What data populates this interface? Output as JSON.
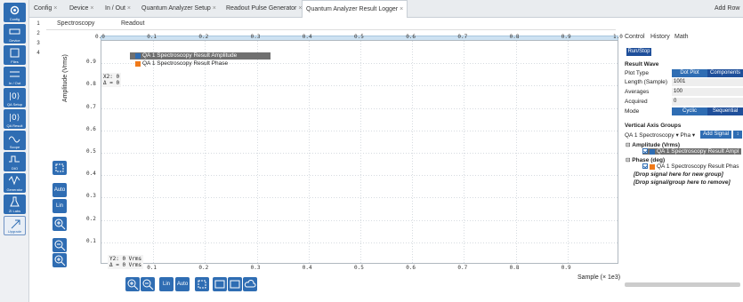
{
  "tabs": {
    "items": [
      "Config",
      "Device",
      "In / Out",
      "Quantum Analyzer Setup",
      "Readout Pulse Generator",
      "Quantum Analyzer Result Logger"
    ],
    "add_row": "Add Row"
  },
  "sidebar": {
    "items": [
      "Config",
      "Device",
      "Files",
      "In / Out",
      "QA Setup",
      "QA Result",
      "Scope",
      "DIO",
      "Generator",
      "ZI Labs",
      "Upgrade"
    ]
  },
  "rows": [
    "1",
    "2",
    "3",
    "4"
  ],
  "subtabs": {
    "spectroscopy": "Spectroscopy",
    "readout": "Readout"
  },
  "plot": {
    "ylabel": "Amplitude (Vrms)",
    "xlabel": "Sample (× 1e3)",
    "x2_readout": "X2: 0",
    "dx_readout": "Δ = 0",
    "y2_readout": "Y2: 0 Vrms",
    "dy_readout": "Δ = 0 Vrms",
    "legend": [
      {
        "label": "QA 1 Spectroscopy Result Amplitude",
        "color": "#2f6db3"
      },
      {
        "label": "QA 1 Spectroscopy Result Phase",
        "color": "#f07a1a"
      }
    ],
    "btn_auto": "Auto",
    "btn_lin": "Lin"
  },
  "chart_data": {
    "type": "line",
    "xlim": [
      0,
      1
    ],
    "ylim": [
      0,
      1
    ],
    "xticks": [
      "0.0",
      "0.1",
      "0.2",
      "0.3",
      "0.4",
      "0.5",
      "0.6",
      "0.7",
      "0.8",
      "0.9",
      "1.0"
    ],
    "xticks_bottom": [
      "0.1",
      "0.2",
      "0.3",
      "0.4",
      "0.5",
      "0.6",
      "0.7",
      "0.8",
      "0.9"
    ],
    "yticks": [
      "0.9",
      "0.8",
      "0.7",
      "0.6",
      "0.5",
      "0.4",
      "0.3",
      "0.2",
      "0.1"
    ],
    "ylabel": "Amplitude (Vrms)",
    "xlabel": "Sample (× 1e3)",
    "grid": true
  },
  "right": {
    "tabs": [
      "Control",
      "History",
      "Math"
    ],
    "run_stop": "Run/Stop",
    "result_wave": "Result Wave",
    "plot_type_label": "Plot Type",
    "plot_type_dot": "Dot Plot",
    "plot_type_comp": "Components",
    "length_label": "Length (Sample)",
    "length_value": "1001",
    "averages_label": "Averages",
    "averages_value": "100",
    "acquired_label": "Acquired",
    "acquired_value": "0",
    "mode_label": "Mode",
    "mode_cyclic": "Cyclic",
    "mode_seq": "Sequential",
    "vag": "Vertical Axis Groups",
    "vag_select": "QA 1 Spectroscopy",
    "vag_select2": "Pha",
    "add_signal": "Add Signal",
    "tree": {
      "amp": "Amplitude (Vrms)",
      "amp_sig": "QA 1 Spectroscopy Result Ampl",
      "phase": "Phase (deg)",
      "phase_sig": "QA 1 Spectroscopy Result Phas",
      "drop_new": "[Drop signal here for new group]",
      "drop_remove": "[Drop signal/group here to remove]"
    }
  }
}
